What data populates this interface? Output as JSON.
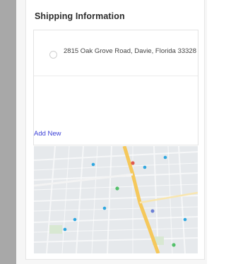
{
  "shipping": {
    "title": "Shipping Information",
    "address": "2815 Oak Grove Road, Davie, Florida 33328",
    "add_new_label": "Add New"
  },
  "colors": {
    "link": "#3a3fd6",
    "highway": "#f5c85b",
    "map_background": "#e6e9ec"
  }
}
